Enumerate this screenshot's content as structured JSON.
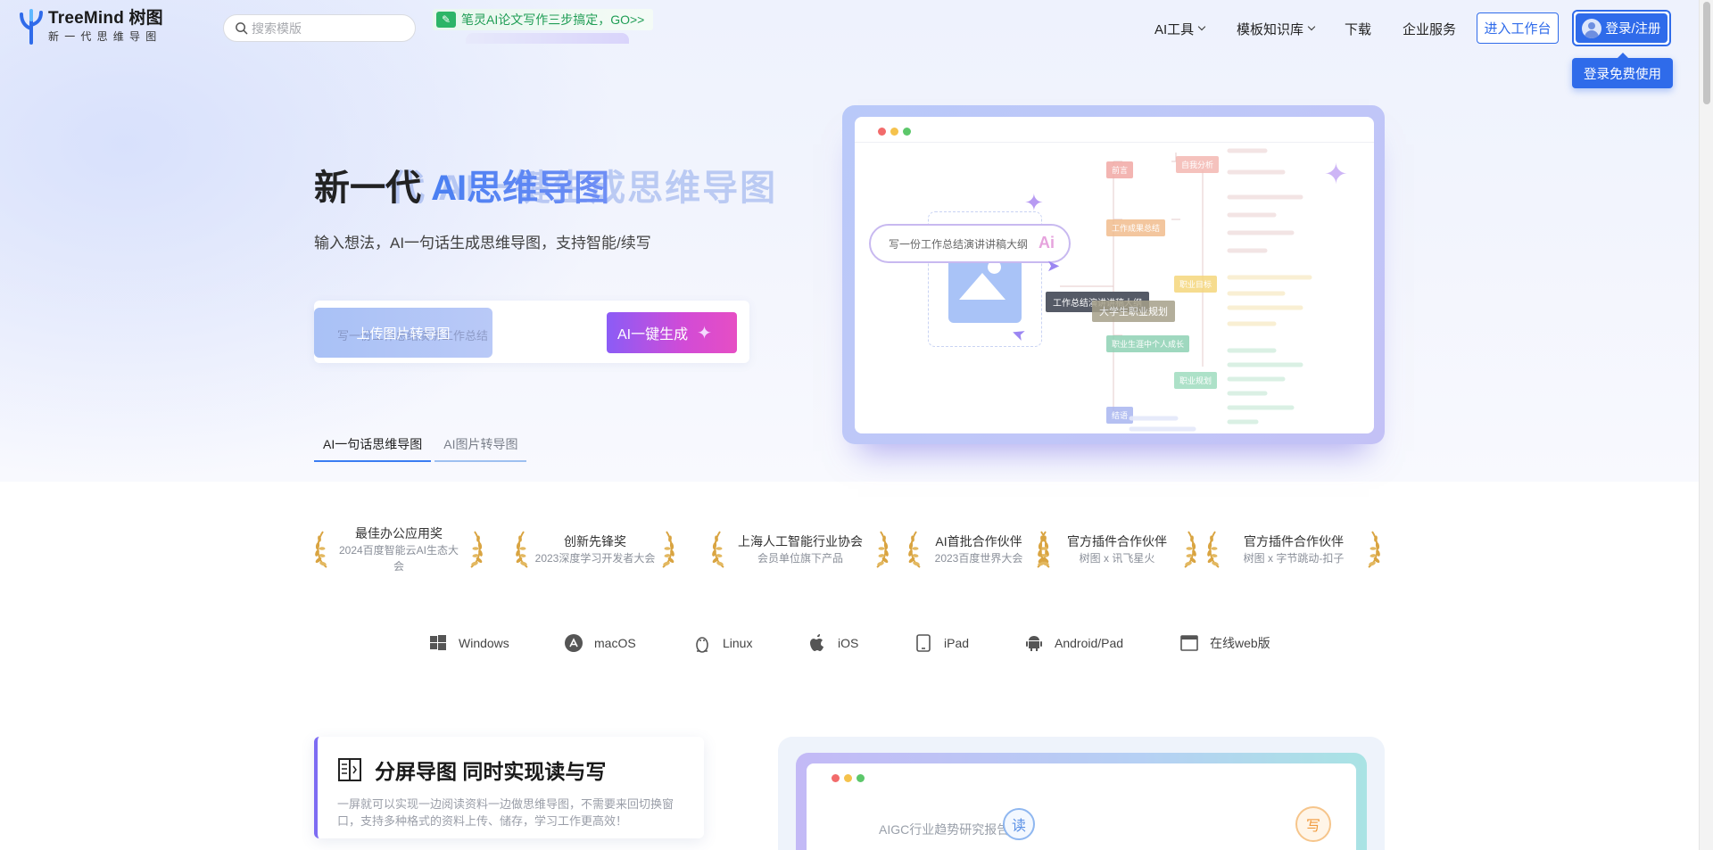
{
  "header": {
    "logo": {
      "title": "TreeMind 树图",
      "subtitle": "新一代思维导图"
    },
    "search": {
      "placeholder": "搜索模版"
    },
    "promo": {
      "icon": "pen-icon",
      "text": "笔灵AI论文写作三步搞定，GO>>"
    },
    "nav": [
      {
        "label": "AI工具",
        "has_dropdown": true
      },
      {
        "label": "模板知识库",
        "has_dropdown": true
      },
      {
        "label": "下载",
        "has_dropdown": false
      },
      {
        "label": "企业服务",
        "has_dropdown": false
      }
    ],
    "workbench_button": "进入工作台",
    "login_button": "登录/注册",
    "login_tooltip": "登录免费使用"
  },
  "hero": {
    "title_prefix": "新一代 ",
    "title_highlight": "AI思维导图",
    "title_ghost": "新一代  AI一键生成思维导图",
    "subtitle": "输入想法，AI一句话生成思维导图，支持智能/续写",
    "subtitle_ghost": "输入想法，AI一句话生成思维导图",
    "upload_button": "上传图片转导图",
    "upload_ghost": "写一份工作总结演讲工作总结",
    "ai_generate_button": "AI一键生成",
    "tabs": [
      {
        "label": "AI一句话思维导图",
        "active": true
      },
      {
        "label": "AI图片转导图",
        "active": false
      }
    ]
  },
  "mockup": {
    "prompt_text": "写一份工作总结演讲讲稿大纲",
    "ai_badge": "Ai",
    "root_node": "工作总结演讲讲稿大纲",
    "center_node": "大学生职业规划",
    "branch_nodes": [
      "前言",
      "工作成果总结",
      "职业生涯中个人成长",
      "结语"
    ],
    "right_nodes": [
      "自我分析",
      "职业目标",
      "职业规划"
    ],
    "traffic_lights": [
      "#f26b6b",
      "#f5c24c",
      "#5cc76a"
    ]
  },
  "awards": [
    {
      "title": "最佳办公应用奖",
      "subtitle": "2024百度智能云AI生态大会"
    },
    {
      "title": "创新先锋奖",
      "subtitle": "2023深度学习开发者大会"
    },
    {
      "title": "上海人工智能行业协会",
      "subtitle": "会员单位旗下产品"
    },
    {
      "title": "AI首批合作伙伴",
      "subtitle": "2023百度世界大会"
    },
    {
      "title": "官方插件合作伙伴",
      "subtitle": "树图 x 讯飞星火"
    },
    {
      "title": "官方插件合作伙伴",
      "subtitle": "树图 x 字节跳动-扣子"
    }
  ],
  "platforms": [
    {
      "label": "Windows",
      "icon": "windows-icon"
    },
    {
      "label": "macOS",
      "icon": "app-store-icon"
    },
    {
      "label": "Linux",
      "icon": "linux-icon"
    },
    {
      "label": "iOS",
      "icon": "apple-icon"
    },
    {
      "label": "iPad",
      "icon": "tablet-icon"
    },
    {
      "label": "Android/Pad",
      "icon": "android-icon"
    },
    {
      "label": "在线web版",
      "icon": "browser-icon"
    }
  ],
  "feature": {
    "title": "分屏导图 同时实现读与写",
    "description": "一屏就可以实现一边阅读资料一边做思维导图，不需要来回切换窗口，支持多种格式的资料上传、储存，学习工作更高效！",
    "preview_report": "AIGC行业趋势研究报告",
    "read_badge": "读",
    "write_badge": "写"
  },
  "colors": {
    "primary": "#2f6bea",
    "ai_gradient_start": "#8b5cf6",
    "ai_gradient_end": "#e64ec4",
    "promo_green": "#1f9d55",
    "laurel_gold": "#d9a441"
  }
}
